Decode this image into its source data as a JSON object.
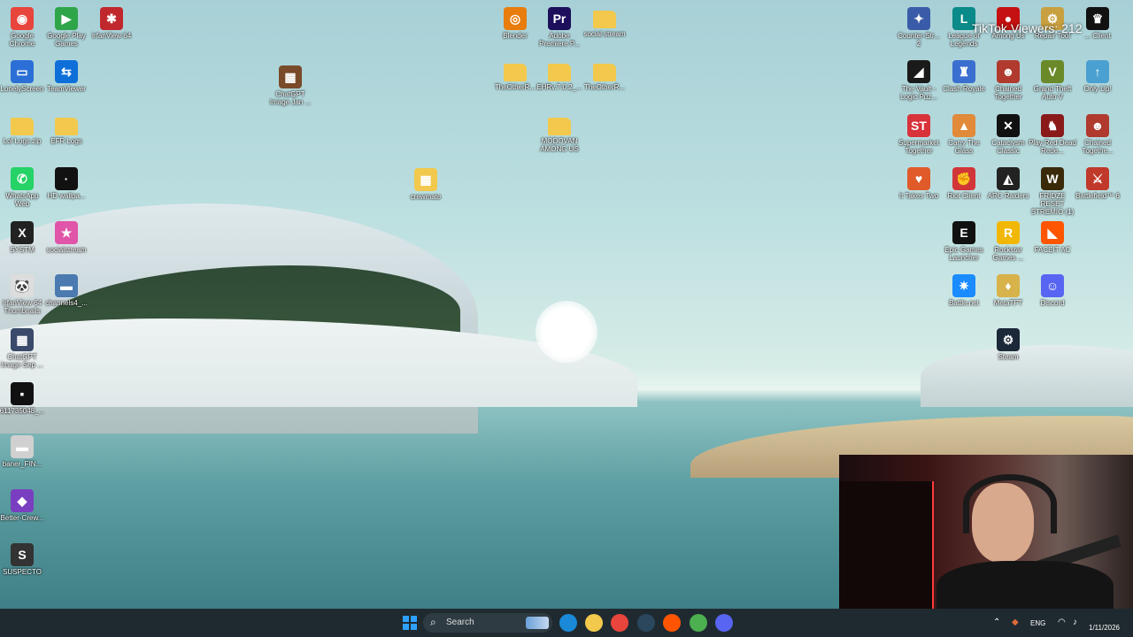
{
  "overlay": {
    "viewers": "TikTok Viewers: 212"
  },
  "desktop_icons": [
    {
      "label": "Google Chrome",
      "icon": "chrome-icon",
      "color": "#e8453c",
      "glyph": "◉"
    },
    {
      "label": "Google Play Games",
      "icon": "play-games-icon",
      "color": "#2fa54a",
      "glyph": "▶"
    },
    {
      "label": "IrfanView 64",
      "icon": "irfanview-icon",
      "color": "#c0282d",
      "glyph": "✱"
    },
    {
      "label": "LonelyScreen",
      "icon": "lonelyscreen-icon",
      "color": "#2b6fd6",
      "glyph": "▭"
    },
    {
      "label": "TeamViewer",
      "icon": "teamviewer-icon",
      "color": "#0e6fd9",
      "glyph": "⇆"
    },
    {
      "label": "ChatGPT Image Jan ...",
      "icon": "image-file-icon",
      "color": "#7a4b2a",
      "glyph": "▦"
    },
    {
      "label": "Lol Logs.zip",
      "icon": "zip-folder-icon",
      "color": "#f2c94c",
      "glyph": ""
    },
    {
      "label": "EFR Logs",
      "icon": "folder-icon",
      "color": "#f2c94c",
      "glyph": ""
    },
    {
      "label": "WhatsApp Web",
      "icon": "whatsapp-icon",
      "color": "#25d366",
      "glyph": "✆"
    },
    {
      "label": "HD wallpa...",
      "icon": "image-file-icon",
      "color": "#111111",
      "glyph": "·"
    },
    {
      "label": "SYSTM",
      "icon": "systm-icon",
      "color": "#222222",
      "glyph": "X"
    },
    {
      "label": "socialstream",
      "icon": "socialstream-icon",
      "color": "#e055a8",
      "glyph": "★"
    },
    {
      "label": "IrfanView 64 Thumbnails",
      "icon": "irfanview-thumbnails-icon",
      "color": "#dddddd",
      "glyph": "🐼"
    },
    {
      "label": "channels4_...",
      "icon": "image-file-icon",
      "color": "#4a7ab0",
      "glyph": "▬"
    },
    {
      "label": "ChatGPT Image Sep ...",
      "icon": "image-file-icon",
      "color": "#3a4a6a",
      "glyph": "▦"
    },
    {
      "label": "611735048_...",
      "icon": "image-file-icon",
      "color": "#111111",
      "glyph": "▪"
    },
    {
      "label": "baner_FIN...",
      "icon": "image-file-icon",
      "color": "#d0d0d0",
      "glyph": "▬"
    },
    {
      "label": "Better-Crew...",
      "icon": "better-crewlink-icon",
      "color": "#7a3fc0",
      "glyph": "◆"
    },
    {
      "label": "SUSPECTO",
      "icon": "suspecto-icon",
      "color": "#333333",
      "glyph": "S"
    },
    {
      "label": "crewmate",
      "icon": "image-file-icon",
      "color": "#f2c94c",
      "glyph": "▦"
    },
    {
      "label": "Blender",
      "icon": "blender-icon",
      "color": "#e87d0d",
      "glyph": "◎"
    },
    {
      "label": "Adobe Premiere P...",
      "icon": "premiere-icon",
      "color": "#1d0f5c",
      "glyph": "Pr"
    },
    {
      "label": "social stream",
      "icon": "folder-icon",
      "color": "#f2c94c",
      "glyph": ""
    },
    {
      "label": "TheOtherR...",
      "icon": "folder-icon",
      "color": "#f2c94c",
      "glyph": ""
    },
    {
      "label": "EHRv.7.0.2_...",
      "icon": "folder-icon",
      "color": "#f2c94c",
      "glyph": ""
    },
    {
      "label": "TheOtherR...",
      "icon": "folder-icon",
      "color": "#f2c94c",
      "glyph": ""
    },
    {
      "label": "MODOVAN AMONG US",
      "icon": "folder-icon",
      "color": "#f2c94c",
      "glyph": ""
    },
    {
      "label": "Counter-Str... 2",
      "icon": "counter-strike-icon",
      "color": "#3a5ca8",
      "glyph": "✦"
    },
    {
      "label": "League of Legends",
      "icon": "league-icon",
      "color": "#0a8a88",
      "glyph": "L"
    },
    {
      "label": "Among Us",
      "icon": "among-us-icon",
      "color": "#c51111",
      "glyph": "●"
    },
    {
      "label": "Repair Tool",
      "icon": "repair-tool-icon",
      "color": "#c8a040",
      "glyph": "⚙"
    },
    {
      "label": "... Client",
      "icon": "client-icon",
      "color": "#111111",
      "glyph": "♛"
    },
    {
      "label": "The Vault - Logic Puz...",
      "icon": "the-vault-icon",
      "color": "#1a1a1a",
      "glyph": "◢"
    },
    {
      "label": "Clash Royale",
      "icon": "clash-royale-icon",
      "color": "#3a6fd0",
      "glyph": "♜"
    },
    {
      "label": "Chained Together",
      "icon": "chained-together-icon",
      "color": "#b03a2e",
      "glyph": "☻"
    },
    {
      "label": "Grand Theft Auto V",
      "icon": "gta-icon",
      "color": "#6a8a2a",
      "glyph": "V"
    },
    {
      "label": "Only Up!",
      "icon": "only-up-icon",
      "color": "#4aa0d0",
      "glyph": "↑"
    },
    {
      "label": "Supermarket Together",
      "icon": "supermarket-icon",
      "color": "#d8323a",
      "glyph": "ST"
    },
    {
      "label": "Carry The Glass",
      "icon": "carry-glass-icon",
      "color": "#e08a3a",
      "glyph": "▲"
    },
    {
      "label": "Cataclysm Classic",
      "icon": "cataclysm-icon",
      "color": "#111111",
      "glyph": "✕"
    },
    {
      "label": "Play Red Dead Rede...",
      "icon": "red-dead-icon",
      "color": "#8a1a1a",
      "glyph": "♞"
    },
    {
      "label": "Chained Togethe...",
      "icon": "chained-together-icon",
      "color": "#b03a2e",
      "glyph": "☻"
    },
    {
      "label": "It Takes Two",
      "icon": "it-takes-two-icon",
      "color": "#e05a2a",
      "glyph": "♥"
    },
    {
      "label": "Riot Client",
      "icon": "riot-client-icon",
      "color": "#d13639",
      "glyph": "✊"
    },
    {
      "label": "ARC Raiders",
      "icon": "arc-raiders-icon",
      "color": "#222222",
      "glyph": "◭"
    },
    {
      "label": "FRIDZE RESET STREMIO (1)",
      "icon": "stremio-icon",
      "color": "#3a2a0a",
      "glyph": "W"
    },
    {
      "label": "Battlefield™ 6",
      "icon": "battlefield-icon",
      "color": "#c0392b",
      "glyph": "⚔"
    },
    {
      "label": "Epic Games Launcher",
      "icon": "epic-games-icon",
      "color": "#111111",
      "glyph": "E"
    },
    {
      "label": "Rockstar Games ...",
      "icon": "rockstar-icon",
      "color": "#f2b705",
      "glyph": "R"
    },
    {
      "label": "FACEIT AC",
      "icon": "faceit-icon",
      "color": "#ff5500",
      "glyph": "◣"
    },
    {
      "label": "Battle.net",
      "icon": "battlenet-icon",
      "color": "#1a8cff",
      "glyph": "✷"
    },
    {
      "label": "MetaTFT",
      "icon": "metatft-icon",
      "color": "#d8b24a",
      "glyph": "♦"
    },
    {
      "label": "Discord",
      "icon": "discord-icon",
      "color": "#5865f2",
      "glyph": "☺"
    },
    {
      "label": "Steam",
      "icon": "steam-icon",
      "color": "#1b2838",
      "glyph": "⚙"
    }
  ],
  "taskbar": {
    "search_label": "Search",
    "apps": [
      {
        "name": "start-icon",
        "color": "#2fa0ff"
      },
      {
        "name": "edge-icon",
        "color": "#1a8ad8"
      },
      {
        "name": "file-explorer-icon",
        "color": "#f2c94c"
      },
      {
        "name": "chrome-icon",
        "color": "#e8453c"
      },
      {
        "name": "steam-icon",
        "color": "#2a475e"
      },
      {
        "name": "faceit-icon",
        "color": "#ff5500"
      },
      {
        "name": "chrome-beta-icon",
        "color": "#4caf50"
      },
      {
        "name": "discord-icon",
        "color": "#5865f2"
      }
    ],
    "tray": {
      "lang": "ENG",
      "date": "1/11/2026"
    }
  }
}
